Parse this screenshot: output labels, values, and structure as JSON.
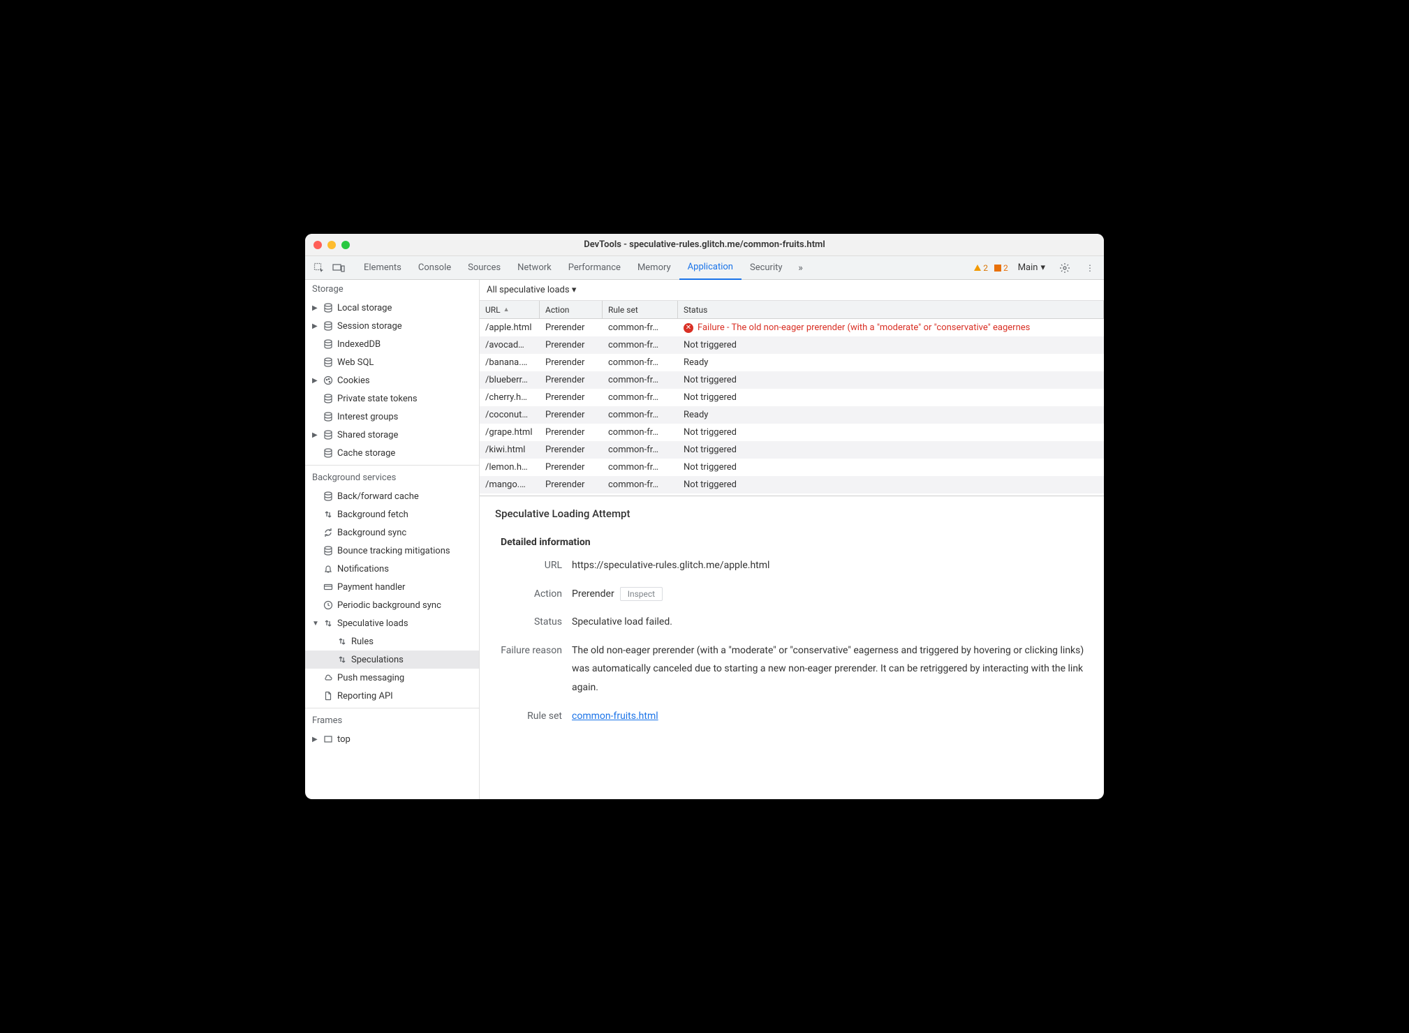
{
  "window": {
    "title": "DevTools - speculative-rules.glitch.me/common-fruits.html"
  },
  "toolbar": {
    "tabs": [
      "Elements",
      "Console",
      "Sources",
      "Network",
      "Performance",
      "Memory",
      "Application",
      "Security"
    ],
    "activeTab": "Application",
    "warnCount": "2",
    "infoCount": "2",
    "mainLabel": "Main"
  },
  "sidebar": {
    "storage": {
      "header": "Storage",
      "items": [
        {
          "label": "Local storage",
          "icon": "db",
          "expand": true
        },
        {
          "label": "Session storage",
          "icon": "db",
          "expand": true
        },
        {
          "label": "IndexedDB",
          "icon": "db"
        },
        {
          "label": "Web SQL",
          "icon": "db"
        },
        {
          "label": "Cookies",
          "icon": "cookie",
          "expand": true
        },
        {
          "label": "Private state tokens",
          "icon": "db"
        },
        {
          "label": "Interest groups",
          "icon": "db"
        },
        {
          "label": "Shared storage",
          "icon": "db",
          "expand": true
        },
        {
          "label": "Cache storage",
          "icon": "db"
        }
      ]
    },
    "background": {
      "header": "Background services",
      "items": [
        {
          "label": "Back/forward cache",
          "icon": "db"
        },
        {
          "label": "Background fetch",
          "icon": "updown"
        },
        {
          "label": "Background sync",
          "icon": "sync"
        },
        {
          "label": "Bounce tracking mitigations",
          "icon": "db"
        },
        {
          "label": "Notifications",
          "icon": "bell"
        },
        {
          "label": "Payment handler",
          "icon": "card"
        },
        {
          "label": "Periodic background sync",
          "icon": "clock"
        },
        {
          "label": "Speculative loads",
          "icon": "updown",
          "expand": true,
          "open": true,
          "children": [
            {
              "label": "Rules",
              "icon": "updown"
            },
            {
              "label": "Speculations",
              "icon": "updown",
              "selected": true
            }
          ]
        },
        {
          "label": "Push messaging",
          "icon": "cloud"
        },
        {
          "label": "Reporting API",
          "icon": "doc"
        }
      ]
    },
    "frames": {
      "header": "Frames",
      "items": [
        {
          "label": "top",
          "icon": "rect",
          "expand": true
        }
      ]
    }
  },
  "content": {
    "filterLabel": "All speculative loads",
    "columns": {
      "url": "URL",
      "action": "Action",
      "ruleset": "Rule set",
      "status": "Status"
    },
    "rows": [
      {
        "url": "/apple.html",
        "action": "Prerender",
        "ruleset": "common-fr…",
        "status": "Failure - The old non-eager prerender (with a \"moderate\" or \"conservative\" eagernes",
        "failure": true
      },
      {
        "url": "/avocad…",
        "action": "Prerender",
        "ruleset": "common-fr…",
        "status": "Not triggered"
      },
      {
        "url": "/banana.…",
        "action": "Prerender",
        "ruleset": "common-fr…",
        "status": "Ready"
      },
      {
        "url": "/blueberr…",
        "action": "Prerender",
        "ruleset": "common-fr…",
        "status": "Not triggered"
      },
      {
        "url": "/cherry.h…",
        "action": "Prerender",
        "ruleset": "common-fr…",
        "status": "Not triggered"
      },
      {
        "url": "/coconut…",
        "action": "Prerender",
        "ruleset": "common-fr…",
        "status": "Ready"
      },
      {
        "url": "/grape.html",
        "action": "Prerender",
        "ruleset": "common-fr…",
        "status": "Not triggered"
      },
      {
        "url": "/kiwi.html",
        "action": "Prerender",
        "ruleset": "common-fr…",
        "status": "Not triggered"
      },
      {
        "url": "/lemon.h…",
        "action": "Prerender",
        "ruleset": "common-fr…",
        "status": "Not triggered"
      },
      {
        "url": "/mango.…",
        "action": "Prerender",
        "ruleset": "common-fr…",
        "status": "Not triggered"
      }
    ],
    "detail": {
      "title": "Speculative Loading Attempt",
      "sectionTitle": "Detailed information",
      "labels": {
        "url": "URL",
        "action": "Action",
        "status": "Status",
        "failureReason": "Failure reason",
        "ruleSet": "Rule set"
      },
      "url": "https://speculative-rules.glitch.me/apple.html",
      "action": "Prerender",
      "inspectLabel": "Inspect",
      "status": "Speculative load failed.",
      "failureReason": "The old non-eager prerender (with a \"moderate\" or \"conservative\" eagerness and triggered by hovering or clicking links) was automatically canceled due to starting a new non-eager prerender. It can be retriggered by interacting with the link again.",
      "ruleSet": "common-fruits.html"
    }
  }
}
